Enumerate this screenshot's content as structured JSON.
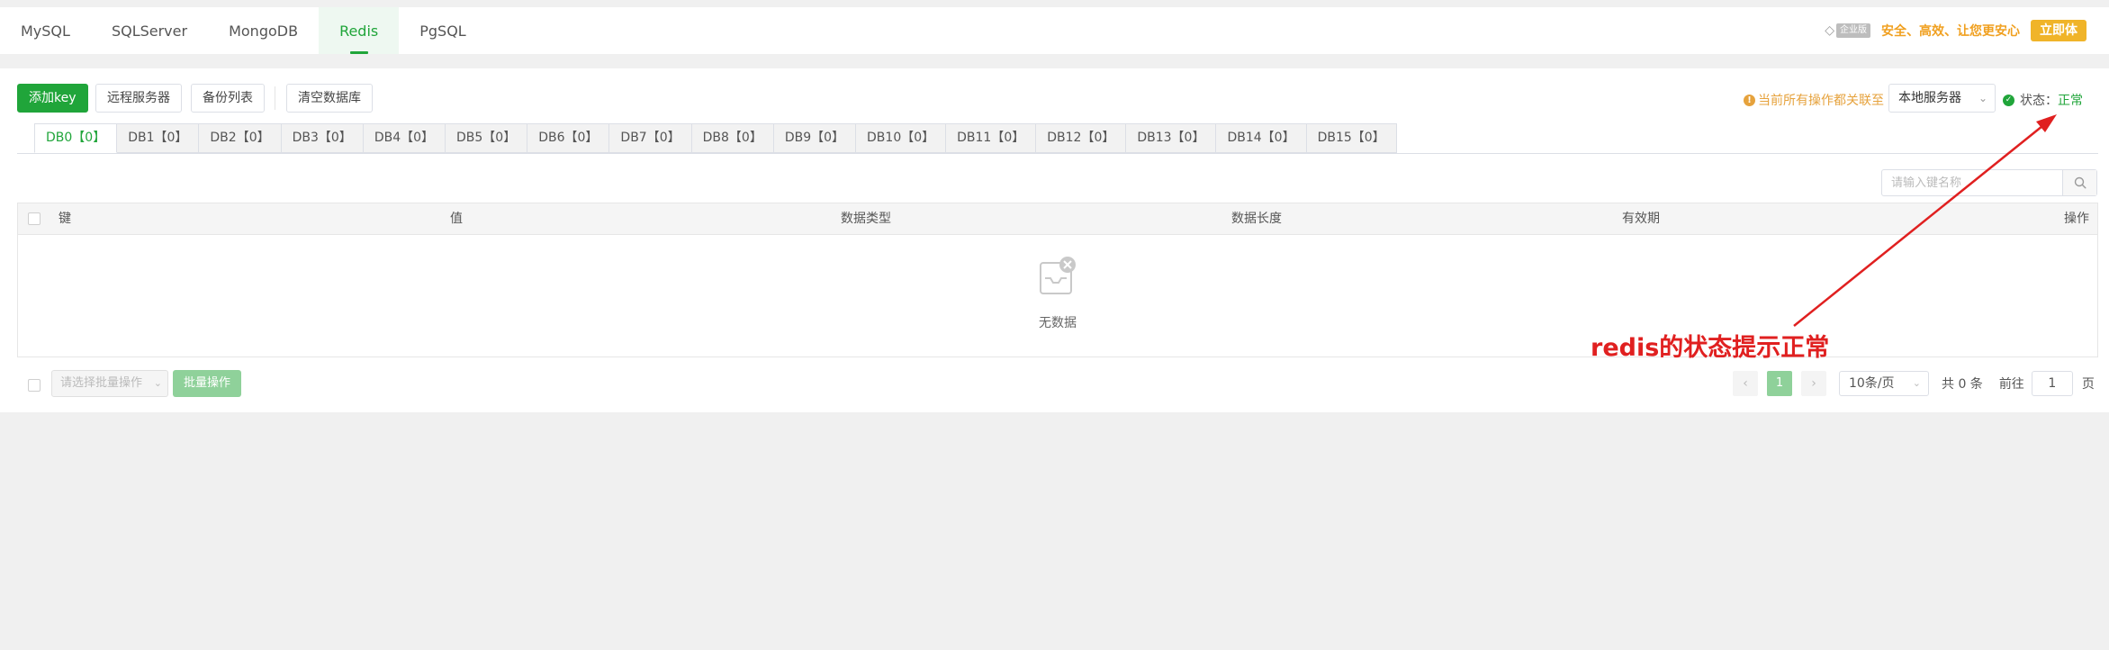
{
  "topnav": {
    "tabs": [
      {
        "label": "MySQL",
        "active": false
      },
      {
        "label": "SQLServer",
        "active": false
      },
      {
        "label": "MongoDB",
        "active": false
      },
      {
        "label": "Redis",
        "active": true
      },
      {
        "label": "PgSQL",
        "active": false
      }
    ],
    "promo": {
      "badge": "企业版",
      "text": "安全、高效、让您更安心",
      "button": "立即体"
    }
  },
  "toolbar": {
    "add_key": "添加key",
    "remote_server": "远程服务器",
    "backup_list": "备份列表",
    "clear_db": "清空数据库",
    "notice": "当前所有操作都关联至",
    "server_select": "本地服务器",
    "status_label": "状态：",
    "status_value": "正常"
  },
  "db_tabs": [
    "DB0【0】",
    "DB1【0】",
    "DB2【0】",
    "DB3【0】",
    "DB4【0】",
    "DB5【0】",
    "DB6【0】",
    "DB7【0】",
    "DB8【0】",
    "DB9【0】",
    "DB10【0】",
    "DB11【0】",
    "DB12【0】",
    "DB13【0】",
    "DB14【0】",
    "DB15【0】"
  ],
  "search": {
    "placeholder": "请输入键名称"
  },
  "table": {
    "columns": {
      "key": "键",
      "value": "值",
      "type": "数据类型",
      "length": "数据长度",
      "ttl": "有效期",
      "ops": "操作"
    },
    "empty_text": "无数据"
  },
  "footer": {
    "bulk_select_placeholder": "请选择批量操作",
    "bulk_button": "批量操作",
    "current_page": "1",
    "page_size": "10条/页",
    "total": "共 0 条",
    "goto_label": "前往",
    "goto_value": "1",
    "goto_unit": "页"
  },
  "annotation": {
    "text": "redis的状态提示正常",
    "color": "#e02020"
  },
  "colors": {
    "accent": "#20a53a",
    "warning": "#e6a23c",
    "annotation": "#e02020"
  }
}
